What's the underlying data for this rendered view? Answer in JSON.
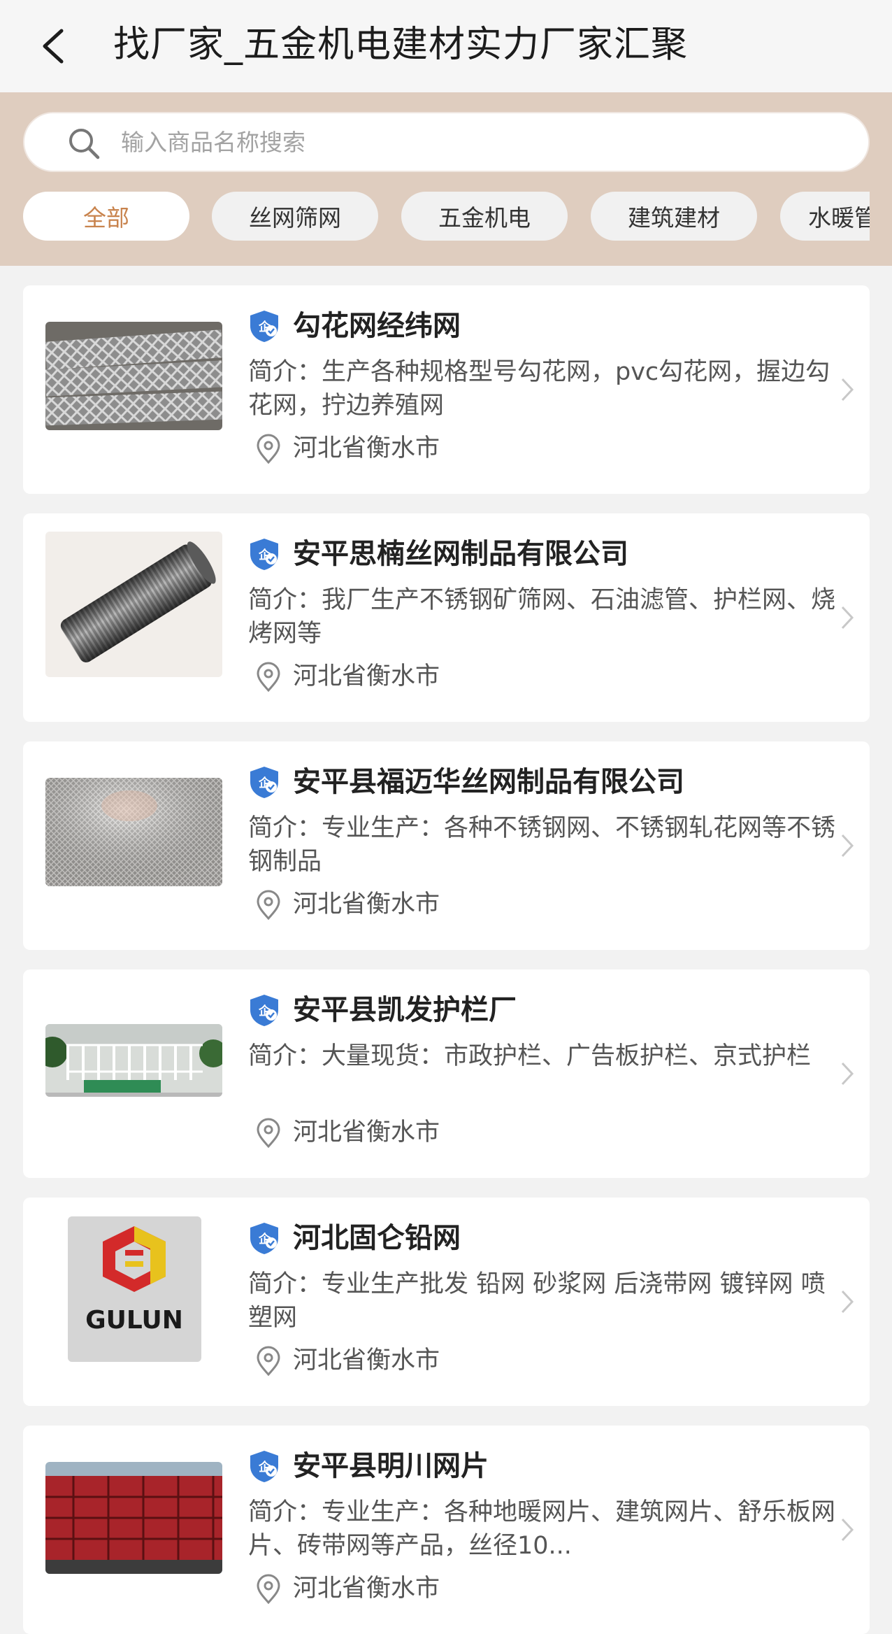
{
  "header": {
    "title": "找厂家_五金机电建材实力厂家汇聚"
  },
  "search": {
    "placeholder": "输入商品名称搜索"
  },
  "categories": [
    {
      "label": "全部",
      "active": true
    },
    {
      "label": "丝网筛网",
      "active": false
    },
    {
      "label": "五金机电",
      "active": false
    },
    {
      "label": "建筑建材",
      "active": false
    },
    {
      "label": "水暖管",
      "active": false
    }
  ],
  "companies": [
    {
      "name": "勾花网经纬网",
      "intro": "简介：生产各种规格型号勾花网，pvc勾花网，握边勾花网，拧边养殖网",
      "location": "河北省衡水市"
    },
    {
      "name": "安平思楠丝网制品有限公司",
      "intro": "简介：我厂生产不锈钢矿筛网、石油滤管、护栏网、烧烤网等",
      "location": "河北省衡水市"
    },
    {
      "name": "安平县福迈华丝网制品有限公司",
      "intro": "简介：专业生产：各种不锈钢网、不锈钢轧花网等不锈钢制品",
      "location": "河北省衡水市"
    },
    {
      "name": "安平县凯发护栏厂",
      "intro": "简介：大量现货：市政护栏、广告板护栏、京式护栏",
      "location": "河北省衡水市"
    },
    {
      "name": "河北固仑铅网",
      "intro": "简介：专业生产批发 铅网 砂浆网 后浇带网 镀锌网 喷塑网",
      "location": "河北省衡水市",
      "logo_text": "GULUN"
    },
    {
      "name": "安平县明川网片",
      "intro": "简介：专业生产：各种地暖网片、建筑网片、舒乐板网片、砖带网等产品，丝径10...",
      "location": "河北省衡水市"
    }
  ],
  "colors": {
    "accent": "#c8834d",
    "filter_bg": "#dfcdbf",
    "verify_blue": "#3a7bd5"
  }
}
